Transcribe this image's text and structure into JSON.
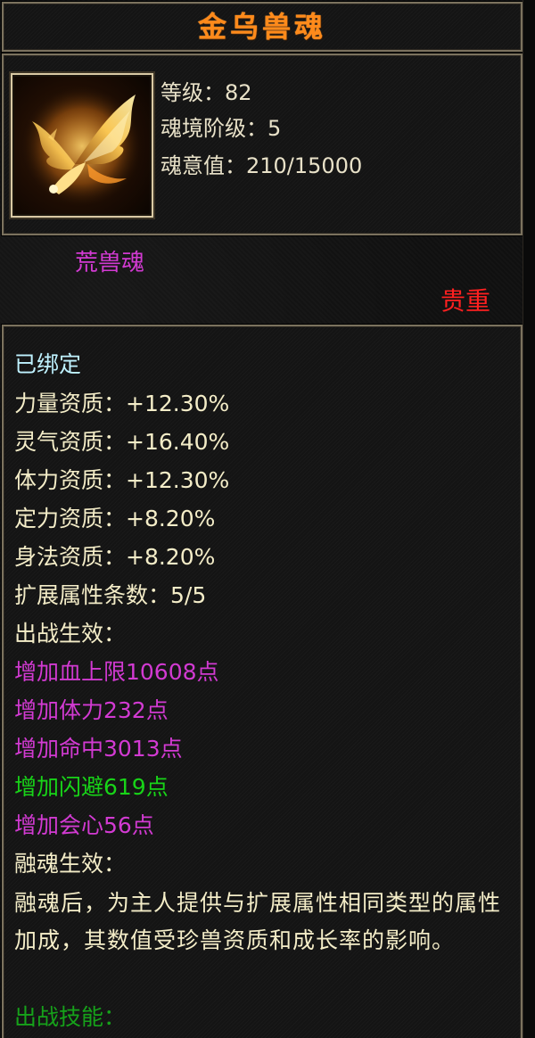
{
  "title": "金乌兽魂",
  "header": {
    "level": "等级：82",
    "stage": "魂境阶级：5",
    "soul_value": "魂意值：210/15000"
  },
  "soul_type": "荒兽魂",
  "rarity": "贵重",
  "bound": "已绑定",
  "aptitudes": [
    "力量资质：+12.30%",
    "灵气资质：+16.40%",
    "体力资质：+12.30%",
    "定力资质：+8.20%",
    "身法资质：+8.20%"
  ],
  "ext_count": "扩展属性条数：5/5",
  "battle_effect_title": "出战生效：",
  "battle_effects": [
    "增加血上限10608点",
    "增加体力232点",
    "增加命中3013点",
    "增加闪避619点",
    "增加会心56点"
  ],
  "fusion_title": "融魂生效：",
  "fusion_desc": "融魂后，为主人提供与扩展属性相同类型的属性加成，其数值受珍兽资质和成长率的影响。",
  "battle_skill_title": "出战技能：",
  "colors": {
    "title": "#ff8a1a",
    "purple": "#d23ad2",
    "green": "#18d418",
    "rarity_red": "#ff2020",
    "border": "#7b725e"
  },
  "icon": "golden-crow-phoenix-icon"
}
